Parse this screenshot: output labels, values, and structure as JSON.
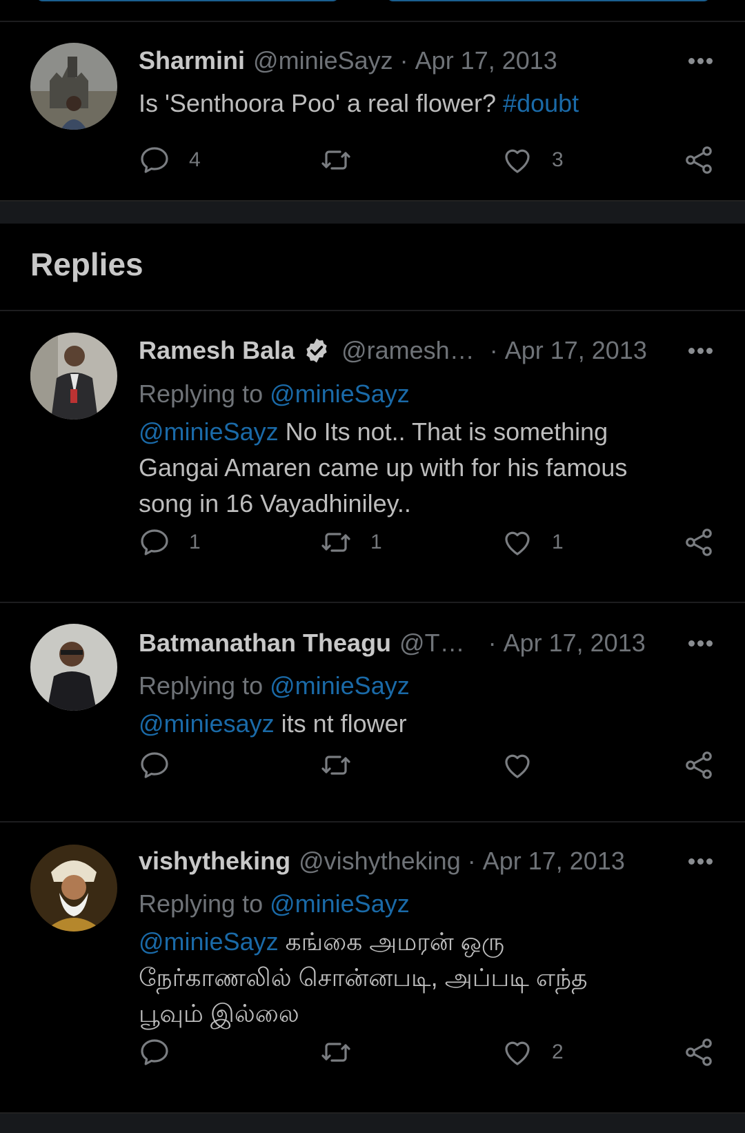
{
  "main_tweet": {
    "name": "Sharmini",
    "handle": "@minieSayz",
    "sep": "·",
    "date": "Apr 17, 2013",
    "text": "Is 'Senthoora Poo' a real flower? ",
    "hashtag": "#doubt",
    "reply_count": "4",
    "retweet_count": "",
    "like_count": "3"
  },
  "replies_title": "Replies",
  "replies": [
    {
      "name": "Ramesh Bala",
      "verified": true,
      "handle": "@ramesh…",
      "sep": "·",
      "date": "Apr 17, 2013",
      "replying_label": "Replying to ",
      "replying_to": "@minieSayz",
      "mention": "@minieSayz",
      "lines": [
        " No Its not.. That is something",
        "Gangai Amaren came up with for his famous",
        "song in 16 Vayadhiniley.."
      ],
      "reply_count": "1",
      "retweet_count": "1",
      "like_count": "1"
    },
    {
      "name": "Batmanathan Theagu",
      "verified": false,
      "handle": "@T…",
      "sep": "·",
      "date": "Apr 17, 2013",
      "replying_label": "Replying to ",
      "replying_to": "@minieSayz",
      "mention": "@miniesayz",
      "lines": [
        " its nt flower"
      ],
      "reply_count": "",
      "retweet_count": "",
      "like_count": ""
    },
    {
      "name": "vishytheking",
      "verified": false,
      "handle": "@vishytheking",
      "sep": "·",
      "date": "Apr 17, 2013",
      "replying_label": "Replying to ",
      "replying_to": "@minieSayz",
      "mention": "@minieSayz",
      "lines": [
        " கங்கை அமரன் ஒரு",
        "நேர்காணலில் சொன்னபடி, அப்படி எந்த",
        "பூவும் இல்லை"
      ],
      "reply_count": "",
      "retweet_count": "",
      "like_count": "2"
    }
  ],
  "colors": {
    "link": "#1a6aa8",
    "muted": "#6f7378",
    "background": "#000000"
  },
  "icons": [
    "reply-icon",
    "retweet-icon",
    "like-icon",
    "share-icon",
    "more-icon",
    "verified-icon"
  ]
}
